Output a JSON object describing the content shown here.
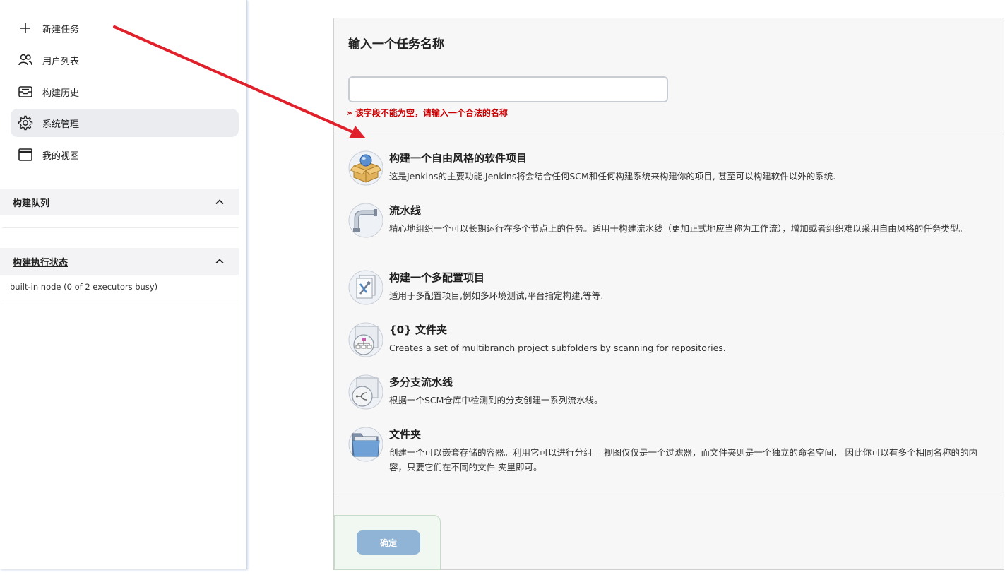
{
  "sidebar": {
    "items": [
      {
        "label": "新建任务",
        "icon": "plus-icon"
      },
      {
        "label": "用户列表",
        "icon": "users-icon"
      },
      {
        "label": "构建历史",
        "icon": "inbox-icon"
      },
      {
        "label": "系统管理",
        "icon": "gear-icon"
      },
      {
        "label": "我的视图",
        "icon": "window-icon"
      }
    ],
    "build_queue": {
      "title": "构建队列"
    },
    "executor_status": {
      "title": "构建执行状态",
      "node": "built-in node (0 of 2 executors busy)"
    }
  },
  "form": {
    "title": "输入一个任务名称",
    "name_value": "",
    "error": "» 该字段不能为空，请输入一个合法的名称"
  },
  "items": [
    {
      "title": "构建一个自由风格的软件项目",
      "desc": "这是Jenkins的主要功能.Jenkins将会结合任何SCM和任何构建系统来构建你的项目, 甚至可以构建软件以外的系统.",
      "icon": "freestyle-package-icon"
    },
    {
      "title": "流水线",
      "desc": "精心地组织一个可以长期运行在多个节点上的任务。适用于构建流水线（更加正式地应当称为工作流），增加或者组织难以采用自由风格的任务类型。",
      "icon": "pipeline-icon"
    },
    {
      "title": "构建一个多配置项目",
      "desc": "适用于多配置项目,例如多环境测试,平台指定构建,等等.",
      "icon": "multi-config-icon"
    },
    {
      "title": "{0} 文件夹",
      "desc": "Creates a set of multibranch project subfolders by scanning for repositories.",
      "icon": "organization-folder-icon"
    },
    {
      "title": "多分支流水线",
      "desc": "根据一个SCM仓库中检测到的分支创建一系列流水线。",
      "icon": "multibranch-icon"
    },
    {
      "title": "文件夹",
      "desc": "创建一个可以嵌套存储的容器。利用它可以进行分组。 视图仅仅是一个过滤器，而文件夹则是一个独立的命名空间， 因此你可以有多个相同名称的的内容，只要它们在不同的文件 夹里即可。",
      "icon": "folder-icon"
    }
  ],
  "ok_button": {
    "label": "确定"
  },
  "colors": {
    "error": "#cc0000",
    "ok_button": "#8fb4d6",
    "annotation_arrow": "#e0202a",
    "active_nav": "#ebecf0"
  }
}
